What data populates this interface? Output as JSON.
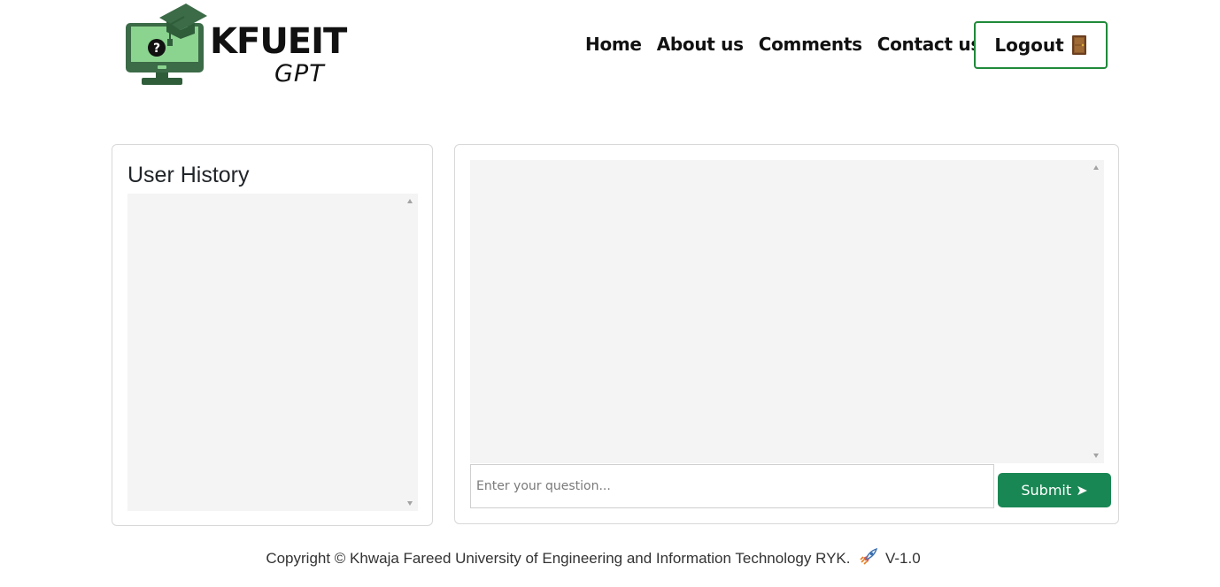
{
  "header": {
    "logo_title": "KFUEIT",
    "logo_subtitle": "GPT",
    "nav": {
      "home": "Home",
      "about": "About us",
      "comments": "Comments",
      "contact": "Contact us"
    },
    "logout_label": "Logout",
    "logout_icon": "door-icon"
  },
  "history": {
    "title": "User History"
  },
  "chat": {
    "placeholder": "Enter your question...",
    "submit_label": "Submit ➤"
  },
  "footer": {
    "copyright": "Copyright © Khwaja Fareed University of Engineering and Information Technology RYK.",
    "rocket_icon": "rocket-icon",
    "version": "V-1.0"
  },
  "colors": {
    "accent": "#198754",
    "logout_border": "#1f8a3a",
    "panel_bg": "#f4f4f4"
  }
}
